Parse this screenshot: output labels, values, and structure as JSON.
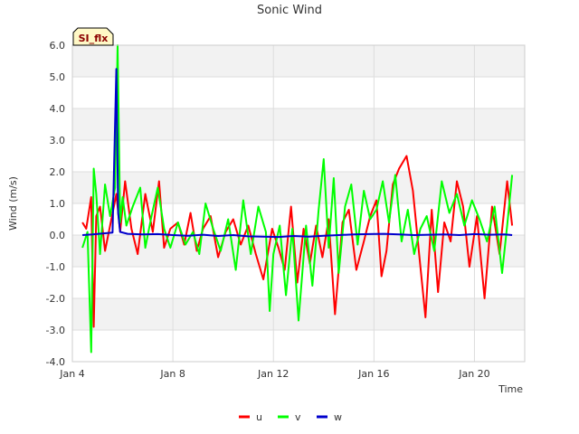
{
  "colors": {
    "u": "#ff0000",
    "v": "#00ff00",
    "w": "#0000cc",
    "band": "#f2f2f2",
    "grid": "#dddddd",
    "badge_fill": "#fff8c6"
  },
  "chart_data": {
    "type": "line",
    "title": "Sonic Wind",
    "xlabel": "Time",
    "ylabel": "Wind (m/s)",
    "badge": "SI_flx",
    "x_unit": "day of January",
    "xlim": [
      4,
      22
    ],
    "ylim": [
      -4.0,
      6.0
    ],
    "x_ticks": [
      {
        "value": 4,
        "label": "Jan 4"
      },
      {
        "value": 8,
        "label": "Jan 8"
      },
      {
        "value": 12,
        "label": "Jan 12"
      },
      {
        "value": 16,
        "label": "Jan 16"
      },
      {
        "value": 20,
        "label": "Jan 20"
      }
    ],
    "y_ticks": [
      {
        "value": -4.0,
        "label": "-4.0"
      },
      {
        "value": -3.0,
        "label": "-3.0"
      },
      {
        "value": -2.0,
        "label": "-2.0"
      },
      {
        "value": -1.0,
        "label": "-1.0"
      },
      {
        "value": 0.0,
        "label": "0.0"
      },
      {
        "value": 1.0,
        "label": "1.0"
      },
      {
        "value": 2.0,
        "label": "2.0"
      },
      {
        "value": 3.0,
        "label": "3.0"
      },
      {
        "value": 4.0,
        "label": "4.0"
      },
      {
        "value": 5.0,
        "label": "5.0"
      },
      {
        "value": 6.0,
        "label": "6.0"
      }
    ],
    "grid": true,
    "legend_position": "bottom-center",
    "series": [
      {
        "name": "u",
        "color": "#ff0000",
        "x": [
          4.4,
          4.55,
          4.75,
          4.85,
          4.95,
          5.1,
          5.3,
          5.5,
          5.75,
          5.9,
          6.1,
          6.35,
          6.6,
          6.9,
          7.2,
          7.45,
          7.65,
          7.9,
          8.2,
          8.45,
          8.7,
          8.95,
          9.2,
          9.5,
          9.8,
          10.1,
          10.4,
          10.7,
          11.0,
          11.3,
          11.6,
          11.95,
          12.2,
          12.45,
          12.7,
          12.95,
          13.2,
          13.45,
          13.7,
          13.95,
          14.2,
          14.45,
          14.75,
          15.0,
          15.3,
          15.6,
          15.85,
          16.1,
          16.3,
          16.5,
          16.75,
          17.0,
          17.3,
          17.55,
          17.8,
          18.05,
          18.3,
          18.55,
          18.8,
          19.05,
          19.3,
          19.55,
          19.8,
          20.1,
          20.4,
          20.7,
          21.0,
          21.3,
          21.5
        ],
        "y": [
          0.4,
          0.2,
          1.2,
          -2.9,
          0.6,
          0.9,
          -0.5,
          0.3,
          1.3,
          0.1,
          1.7,
          0.2,
          -0.6,
          1.3,
          0.1,
          1.7,
          -0.4,
          0.2,
          0.4,
          -0.3,
          0.7,
          -0.5,
          0.2,
          0.6,
          -0.7,
          0.1,
          0.5,
          -0.3,
          0.3,
          -0.6,
          -1.4,
          0.2,
          -0.4,
          -1.1,
          0.9,
          -1.5,
          0.2,
          -0.9,
          0.3,
          -0.7,
          0.5,
          -2.5,
          0.4,
          0.8,
          -1.1,
          -0.2,
          0.6,
          1.1,
          -1.3,
          -0.5,
          1.6,
          2.1,
          2.5,
          1.4,
          -0.6,
          -2.6,
          0.8,
          -1.8,
          0.4,
          -0.2,
          1.7,
          0.9,
          -1.0,
          0.6,
          -2.0,
          0.9,
          -0.6,
          1.7,
          0.3
        ]
      },
      {
        "name": "v",
        "color": "#00ff00",
        "x": [
          4.4,
          4.6,
          4.75,
          4.85,
          4.95,
          5.1,
          5.3,
          5.5,
          5.7,
          5.8,
          5.9,
          6.0,
          6.15,
          6.4,
          6.7,
          6.9,
          7.15,
          7.4,
          7.65,
          7.9,
          8.2,
          8.5,
          8.8,
          9.05,
          9.3,
          9.6,
          9.9,
          10.2,
          10.5,
          10.8,
          11.1,
          11.4,
          11.7,
          11.85,
          12.0,
          12.25,
          12.5,
          12.75,
          13.0,
          13.3,
          13.55,
          13.8,
          14.0,
          14.2,
          14.4,
          14.6,
          14.85,
          15.1,
          15.35,
          15.6,
          15.85,
          16.1,
          16.35,
          16.6,
          16.85,
          17.1,
          17.35,
          17.6,
          17.85,
          18.1,
          18.4,
          18.7,
          19.0,
          19.3,
          19.6,
          19.9,
          20.2,
          20.5,
          20.8,
          21.1,
          21.3,
          21.5
        ],
        "y": [
          -0.4,
          0.1,
          -3.7,
          2.1,
          1.3,
          -0.6,
          1.6,
          0.6,
          1.5,
          6.0,
          0.4,
          1.2,
          0.3,
          0.9,
          1.5,
          -0.4,
          0.6,
          1.5,
          0.2,
          -0.4,
          0.4,
          -0.3,
          0.1,
          -0.6,
          1.0,
          0.2,
          -0.5,
          0.5,
          -1.1,
          1.1,
          -0.6,
          0.9,
          0.1,
          -2.4,
          -0.6,
          0.3,
          -1.9,
          0.2,
          -2.7,
          0.3,
          -1.6,
          0.8,
          2.4,
          -0.4,
          1.8,
          -1.2,
          0.9,
          1.6,
          -0.3,
          1.4,
          0.5,
          0.8,
          1.7,
          0.4,
          1.9,
          -0.2,
          0.8,
          -0.6,
          0.2,
          0.6,
          -0.5,
          1.7,
          0.7,
          1.3,
          0.3,
          1.1,
          0.5,
          -0.2,
          0.9,
          -1.2,
          0.3,
          1.9
        ]
      },
      {
        "name": "w",
        "color": "#0000cc",
        "x": [
          4.4,
          4.8,
          5.2,
          5.6,
          5.75,
          5.82,
          5.9,
          6.2,
          6.8,
          7.4,
          8.0,
          8.6,
          9.2,
          9.8,
          10.4,
          11.0,
          11.6,
          12.2,
          12.8,
          13.4,
          14.0,
          14.6,
          15.2,
          15.8,
          16.4,
          17.0,
          17.6,
          18.2,
          18.8,
          19.4,
          20.0,
          20.6,
          21.2,
          21.5
        ],
        "y": [
          0.0,
          0.02,
          0.05,
          0.08,
          5.25,
          0.7,
          0.1,
          0.04,
          0.02,
          0.03,
          0.0,
          -0.02,
          0.01,
          -0.03,
          0.0,
          -0.04,
          -0.05,
          -0.06,
          -0.03,
          -0.05,
          -0.02,
          0.0,
          0.02,
          0.03,
          0.04,
          0.02,
          0.0,
          0.01,
          0.02,
          0.0,
          0.03,
          0.01,
          0.02,
          0.0
        ]
      }
    ]
  }
}
